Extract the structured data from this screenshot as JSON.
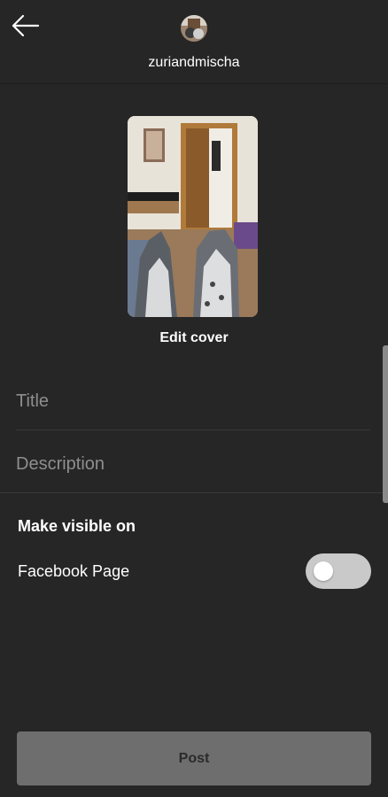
{
  "header": {
    "username": "zuriandmischa",
    "back_icon": "arrow-left-icon"
  },
  "cover": {
    "edit_label": "Edit cover"
  },
  "form": {
    "title_placeholder": "Title",
    "title_value": "",
    "description_placeholder": "Description",
    "description_value": ""
  },
  "visibility": {
    "section_label": "Make visible on",
    "facebook_label": "Facebook Page",
    "facebook_enabled": false
  },
  "footer": {
    "post_label": "Post"
  },
  "colors": {
    "background": "#262626",
    "toggle_off": "#c9c9c9",
    "post_button": "#6e6e6e"
  }
}
